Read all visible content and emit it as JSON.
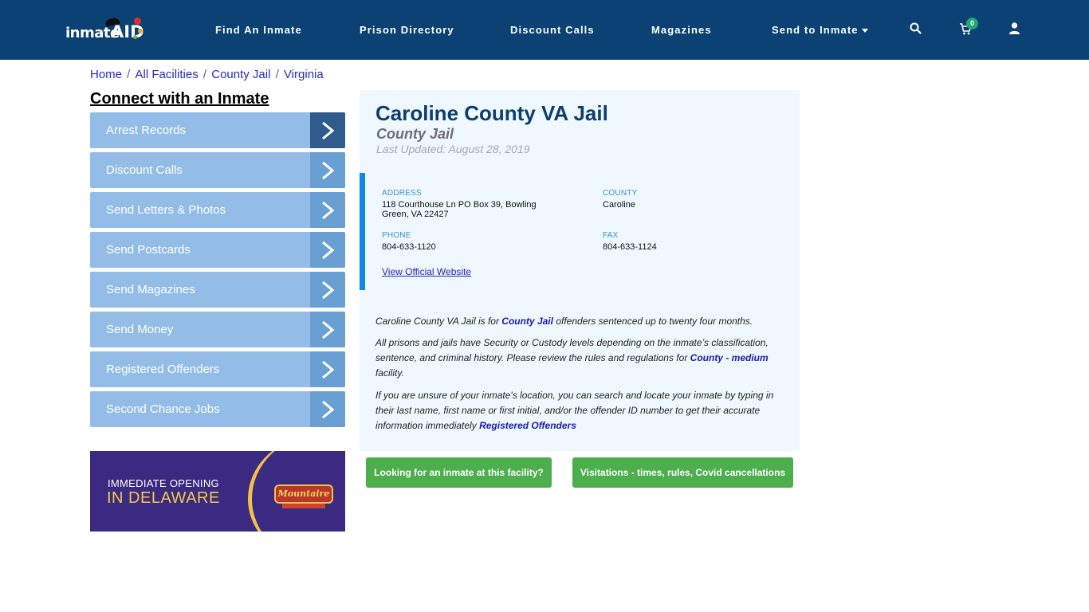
{
  "header": {
    "logo": {
      "main": "inmate",
      "accent": "AID"
    },
    "nav": [
      {
        "label": "Find An Inmate"
      },
      {
        "label": "Prison Directory"
      },
      {
        "label": "Discount Calls"
      },
      {
        "label": "Magazines"
      },
      {
        "label": "Send to Inmate",
        "has_dropdown": true
      }
    ],
    "icons": {
      "search": "search-icon",
      "cart": "cart-icon",
      "user": "user-icon"
    },
    "cart_count": "0",
    "colors": {
      "background": "#0b4173",
      "badge": "#1fa67a"
    }
  },
  "breadcrumb": [
    "Home",
    "All Facilities",
    "County Jail",
    "Virginia"
  ],
  "sidebar": {
    "title": "Connect with an Inmate",
    "items": [
      {
        "label": "Arrest Records",
        "active": true
      },
      {
        "label": "Discount Calls"
      },
      {
        "label": "Send Letters & Photos"
      },
      {
        "label": "Send Postcards"
      },
      {
        "label": "Send Magazines"
      },
      {
        "label": "Send Money"
      },
      {
        "label": "Registered Offenders"
      },
      {
        "label": "Second Chance Jobs"
      }
    ],
    "ad": {
      "line1": "IMMEDIATE OPENING",
      "line2": "IN DELAWARE",
      "brand": "Mountaire"
    }
  },
  "facility": {
    "name": "Caroline County VA Jail",
    "type": "County Jail",
    "last_updated": "Last Updated: August 28, 2019",
    "address_label": "ADDRESS",
    "address_line1": "118 Courthouse Ln PO Box 39, Bowling",
    "address_line2": "Green, VA 22427",
    "county_label": "COUNTY",
    "county": "Caroline",
    "phone_label": "PHONE",
    "phone": "804-633-1120",
    "fax_label": "FAX",
    "fax": "804-633-1124",
    "website_link": "View Official Website"
  },
  "description": {
    "p1_before": "Caroline County VA Jail is for ",
    "p1_link": "County Jail",
    "p1_after": " offenders sentenced up to twenty four months.",
    "p2_before": "All prisons and jails have Security or Custody levels depending on the inmate’s classification, sentence, and criminal history. Please review the rules and regulations for ",
    "p2_link": "County - medium",
    "p2_after": " facility.",
    "p3_before": "If you are unsure of your inmate's location, you can search and locate your inmate by typing in their last name, first name or first initial, and/or the offender ID number to get their accurate information immediately ",
    "p3_link": "Registered Offenders"
  },
  "actions": {
    "find_inmate": "Looking for an inmate at this facility?",
    "visitations": "Visitations - times, rules, Covid cancellations"
  }
}
